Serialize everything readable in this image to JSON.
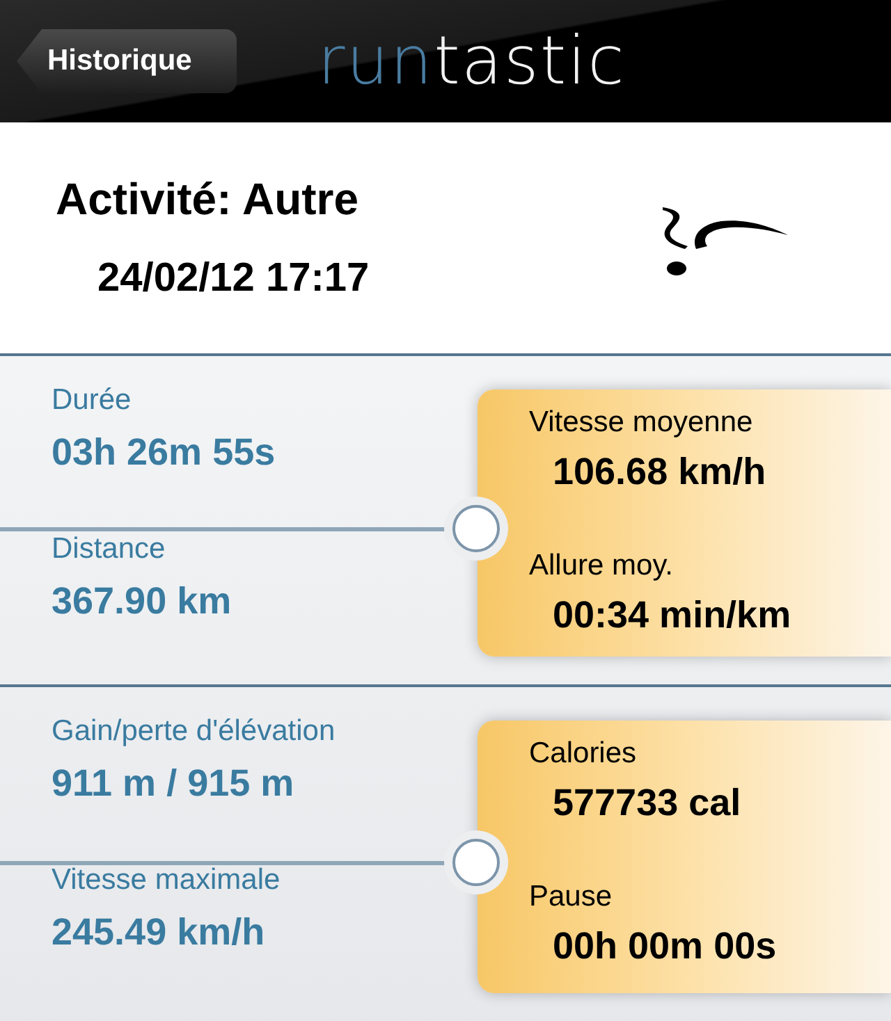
{
  "nav_bar": {
    "back_button": "Historique",
    "logo": {
      "accent": "run",
      "rest": "tastic"
    }
  },
  "activity": {
    "title": "Activité: Autre",
    "date": "24/02/12 17:17"
  },
  "sections": [
    {
      "left": [
        {
          "label": "Durée",
          "value": "03h 26m 55s"
        },
        {
          "label": "Distance",
          "value": "367.90 km"
        }
      ],
      "right": [
        {
          "label": "Vitesse moyenne",
          "value": "106.68 km/h"
        },
        {
          "label": "Allure moy.",
          "value": "00:34 min/km"
        }
      ]
    },
    {
      "left": [
        {
          "label": "Gain/perte d'élévation",
          "value": "911 m / 915 m"
        },
        {
          "label": "Vitesse maximale",
          "value": "245.49 km/h"
        }
      ],
      "right": [
        {
          "label": "Calories",
          "value": "577733 cal"
        },
        {
          "label": "Pause",
          "value": "00h 00m 00s"
        }
      ]
    }
  ]
}
